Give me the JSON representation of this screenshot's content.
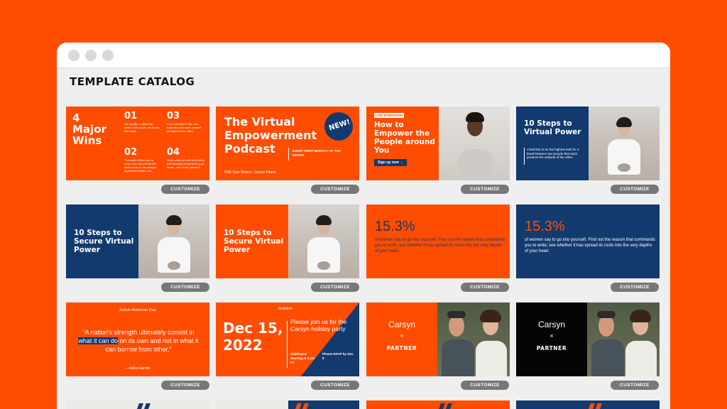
{
  "catalog": {
    "title": "TEMPLATE CATALOG",
    "button_label": "CUSTOMIZE"
  },
  "cards": {
    "c1": {
      "title": "4 Major Wins",
      "n1": "01",
      "n2": "02",
      "n3": "03",
      "n4": "04",
      "t1": "I've my life in widening circles that reach out across the world.",
      "t2": "The work of the eyes is done. Go now and do the heart-work on the images imprisoned within you.",
      "t3": "Love consists in this: two solitudes that meet, protect and greet each other.",
      "t4": "Have patience with everything that remains unsolved in your heart... live in the question."
    },
    "c2": {
      "title": "The Virtual Empowerment Podcast",
      "badge": "NEW!",
      "side": "EVERY FIRST MONDAY OF THE MONTH",
      "hosts": "With Sam Waters, Carsyn Fibers"
    },
    "c3": {
      "label": "LIVE WORKSHOP",
      "title": "How to Empower the People around You",
      "cta": "Sign up now →"
    },
    "c4": {
      "title": "10 Steps to Virtual Power",
      "body": "I hold this to be the highest task for a bond between two people that each protects the solitude of the other."
    },
    "c5": {
      "title": "10 Steps to Secure Virtual Power"
    },
    "c6": {
      "title": "10 Steps to Secure Virtual Power"
    },
    "c7": {
      "stat": "15.3%",
      "body": "of women say to go into yourself. Find out the reason that commands you to write; see whether it has spread its roots into the very depths of your heart."
    },
    "c8": {
      "stat": "15.3%",
      "body": "of women say to go into yourself. Find out the reason that commands you to write; see whether it has spread its roots into the very depths of your heart."
    },
    "c9": {
      "top": "Native American Day",
      "quote_a": "“A nation's strength ultimately consist in ",
      "quote_hl": "what it can do",
      "quote_b": " on its own and not in what it can borrow from other.”",
      "author": "—Indira Gandhi"
    },
    "c10": {
      "top": "Invitation",
      "date": "Dec 15, 2022",
      "title": "Please join us for the Carsyn holiday party",
      "loc": "Clubhouse Starting at 3 pm ET",
      "rsvp": "Please RSVP by Dec 9"
    },
    "c11": {
      "brand": "Carsyn",
      "x": "×",
      "partner": "PARTNER"
    },
    "c12": {
      "brand": "Carsyn",
      "x": "×",
      "partner": "PARTNER"
    }
  },
  "colors": {
    "orange": "#ff4d00",
    "navy": "#123a6e",
    "black": "#050505"
  }
}
